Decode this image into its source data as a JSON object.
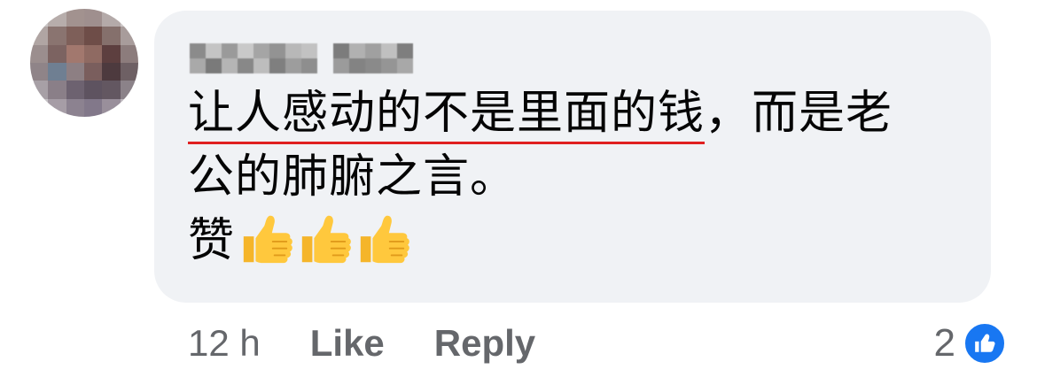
{
  "comment": {
    "line1_underlined": "让人感动的不是里面的钱",
    "line1_rest": "，而是老",
    "line2": "公的肺腑之言。",
    "line3_text": "赞",
    "line3_emoji": [
      "thumbs-up-emoji",
      "thumbs-up-emoji",
      "thumbs-up-emoji"
    ],
    "underline_color": "#e02020"
  },
  "footer": {
    "timestamp": "12 h",
    "like_label": "Like",
    "reply_label": "Reply"
  },
  "reactions": {
    "count": "2",
    "icon": "like-icon",
    "badge_color": "#1877f2"
  },
  "colors": {
    "bubble_bg": "#f0f2f5",
    "text": "#050505",
    "meta": "#65676b"
  }
}
